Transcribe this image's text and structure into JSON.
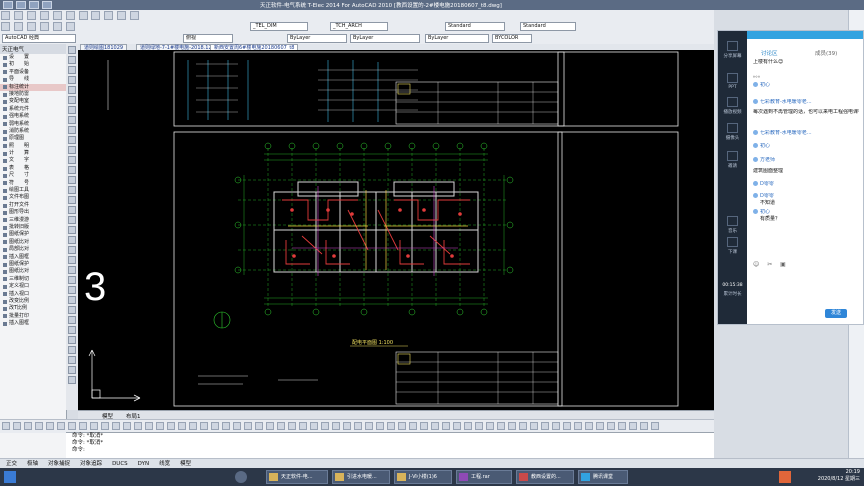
{
  "window": {
    "title": "天正软件-电气系统 T-Elec 2014  For AutoCAD 2010    [教西设置的-2#楼电施20180607_t8.dwg]"
  },
  "toolbar_combos": {
    "layer": "_TEL_DIM",
    "arch": "_TCH_ARCH",
    "style1": "Standard",
    "style2": "Standard",
    "workspace": "AutoCAD 经典",
    "linetype1": "ByLayer",
    "linetype2": "ByLayer",
    "lineweight": "ByLayer",
    "color": "BYCOLOR",
    "view": "俯视"
  },
  "doc_tabs": [
    "道则绘图181029",
    "道则绿地-7-1#楼电施-2018.12",
    "新西安置周6#楼电施20180607_t8"
  ],
  "left_panel": {
    "header": "天正电气",
    "items": [
      "设　　置",
      "初　　始",
      "平面设备",
      "导　　线",
      "标注统计",
      "接地防雷",
      "变配电室",
      "系统元件",
      "强电系统",
      "弱电系统",
      "消防系统",
      "原理图",
      "照　　明",
      "计　　算",
      "文　　字",
      "表　　格",
      "尺　　寸",
      "符　　号",
      "绘图工具",
      "文件布图",
      "打开文件",
      "图形导出",
      "三维漫游",
      "批转旧版",
      "图纸保护",
      "图纸比对",
      "局部比对",
      "插入图框",
      "图纸保护",
      "图纸比对",
      "三维制切",
      "定义视口",
      "插入视口",
      "改变比例",
      "改T比例",
      "批量打印",
      "插入图框"
    ]
  },
  "model_tabs": [
    "模型",
    "布局1"
  ],
  "command_lines": [
    "命令: *取消*",
    "命令: *取消*",
    "命令:"
  ],
  "main_status": [
    "正交",
    "极轴",
    "对象捕捉",
    "对象追踪",
    "DUCS",
    "DYN",
    "线宽",
    "模型"
  ],
  "canvas_labels": {
    "big_three": "3",
    "plan_title": "配电平面图 1:100"
  },
  "chat": {
    "tabs": {
      "discuss": "讨论区",
      "members": "成员(39)"
    },
    "sidebar": [
      "分享屏幕",
      "PPT",
      "播放视频",
      "摄像头",
      "邀请",
      "音乐",
      "下课"
    ],
    "timer": "00:15:38",
    "timer_label": "累计时长",
    "messages": [
      {
        "name": "",
        "text": "上楼有什么😊"
      },
      {
        "name": "",
        "text": "。。。"
      },
      {
        "name": "初心",
        "text": ""
      },
      {
        "name": "七彩教育-水电暖零老...",
        "text": ""
      },
      {
        "name": "",
        "text": "每次遇到不再管理的话，也可以来电工程强电课学习的"
      },
      {
        "name": "七彩教育-水电暖零老...",
        "text": ""
      },
      {
        "name": "初心",
        "text": ""
      },
      {
        "name": "方老师",
        "text": ""
      },
      {
        "name": "",
        "text": "建筑图面整理"
      },
      {
        "name": "D零零",
        "text": ""
      },
      {
        "name": "D零零",
        "text": "不知道"
      },
      {
        "name": "初心",
        "text": "有质量？"
      }
    ],
    "send": "发送"
  },
  "taskbar": {
    "items": [
      "天正软件-电...",
      "引进水电暖...",
      "J-Ⅵ小楼(1)6",
      "工程.rar",
      "教西设置的...",
      "腾讯课堂"
    ],
    "clock_time": "20:19",
    "clock_date": "2020/8/12 星期三"
  },
  "colors": {
    "canvas": "#000000",
    "titlebar": "#5b6b84",
    "taskbar": "#2c3748",
    "chat_accent": "#32a3e0"
  }
}
